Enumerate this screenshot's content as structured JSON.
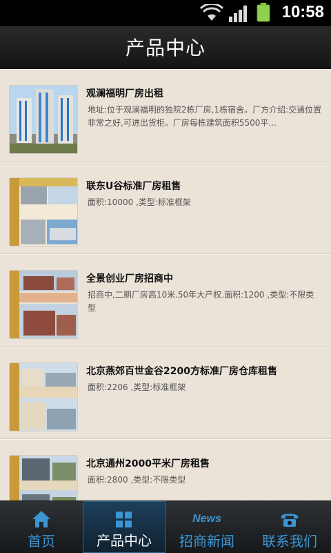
{
  "status_bar": {
    "time": "10:58"
  },
  "header": {
    "title": "产品中心"
  },
  "products": [
    {
      "title": "观澜福明厂房出租",
      "desc": "地址:位于观澜福明的独院2栋厂房,1栋宿舍。厂方介绍:交通位置非常之好,可进出货柜。厂房每栋建筑面积5500平..."
    },
    {
      "title": "联东U谷标准厂房租售",
      "desc": "面积:10000 ,类型:标准框架"
    },
    {
      "title": "全景创业厂房招商中",
      "desc": "招商中,二期厂房高10米.50年大产权.面积:1200 ,类型:不限类型"
    },
    {
      "title": "北京燕郊百世金谷2200方标准厂房仓库租售",
      "desc": "面积:2206 ,类型:标准框架"
    },
    {
      "title": "北京通州2000平米厂房租售",
      "desc": "面积:2800 ,类型:不限类型"
    }
  ],
  "bottom_nav": [
    {
      "label": "首页",
      "icon": "home-icon",
      "active": false
    },
    {
      "label": "产品中心",
      "icon": "grid-icon",
      "active": true
    },
    {
      "label": "招商新闻",
      "icon": "news-icon",
      "icon_text": "News",
      "active": false
    },
    {
      "label": "联系我们",
      "icon": "phone-icon",
      "active": false
    }
  ],
  "colors": {
    "accent": "#3b95d4",
    "background": "#ebe3d8",
    "header": "#1e1e1e"
  }
}
